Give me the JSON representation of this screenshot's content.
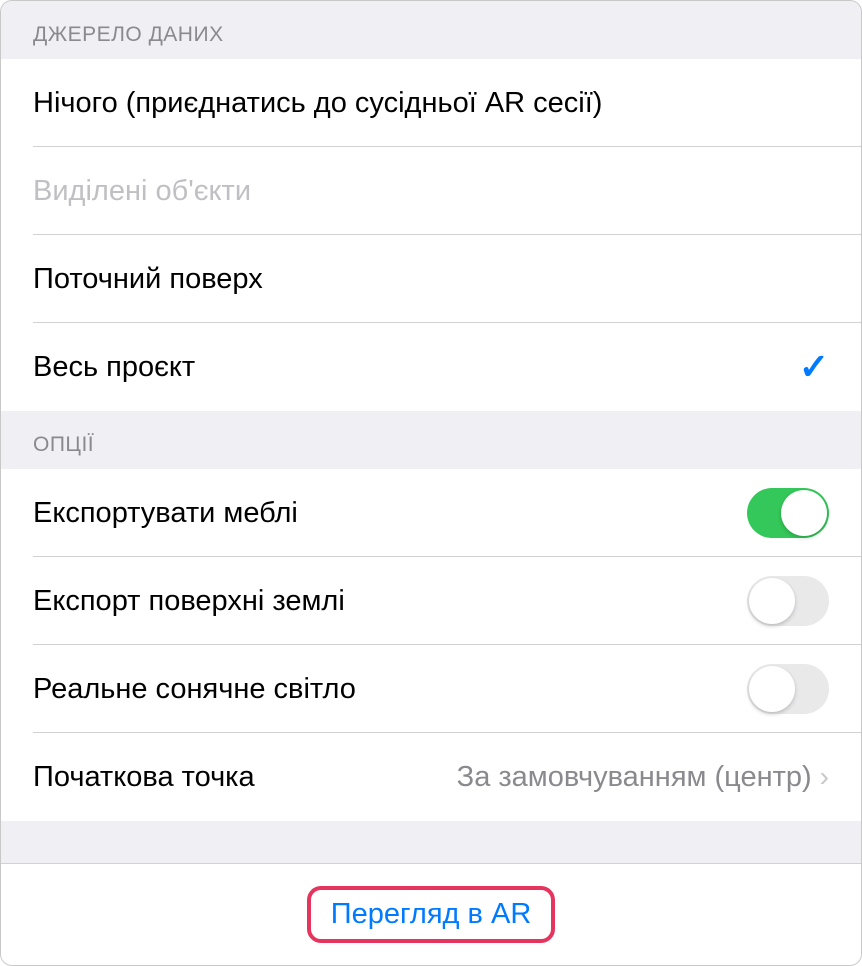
{
  "sections": {
    "dataSource": {
      "header": "ДЖЕРЕЛО ДАНИХ",
      "items": {
        "none": "Нічого (приєднатись до сусідньої AR сесії)",
        "selected": "Виділені об'єкти",
        "currentFloor": "Поточний поверх",
        "wholeProject": "Весь проєкт"
      }
    },
    "options": {
      "header": "ОПЦІЇ",
      "items": {
        "exportFurniture": "Експортувати меблі",
        "exportGround": "Експорт поверхні землі",
        "realSunlight": "Реальне сонячне світло",
        "startPoint": {
          "label": "Початкова точка",
          "value": "За замовчуванням (центр)"
        }
      }
    }
  },
  "footer": {
    "previewButton": "Перегляд в AR"
  }
}
